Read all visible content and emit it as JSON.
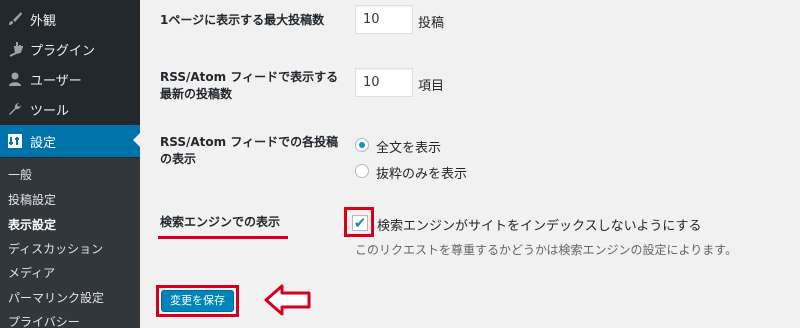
{
  "sidebar": {
    "menu": [
      {
        "label": "外観",
        "icon": "paintbrush-icon"
      },
      {
        "label": "プラグイン",
        "icon": "plugin-icon"
      },
      {
        "label": "ユーザー",
        "icon": "user-icon"
      },
      {
        "label": "ツール",
        "icon": "wrench-icon"
      },
      {
        "label": "設定",
        "icon": "settings-icon",
        "active": true
      }
    ],
    "submenu": [
      {
        "label": "一般"
      },
      {
        "label": "投稿設定"
      },
      {
        "label": "表示設定",
        "current": true
      },
      {
        "label": "ディスカッション"
      },
      {
        "label": "メディア"
      },
      {
        "label": "パーマリンク設定"
      },
      {
        "label": "プライバシー"
      }
    ]
  },
  "settings": {
    "posts_per_page": {
      "label": "1ページに表示する最大投稿数",
      "value": "10",
      "suffix": "投稿"
    },
    "posts_per_rss": {
      "label_line1": "RSS/Atom フィードで表示する",
      "label_line2": "最新の投稿数",
      "value": "10",
      "suffix": "項目"
    },
    "rss_use_excerpt": {
      "label_line1": "RSS/Atom フィードでの各投稿",
      "label_line2": "の表示",
      "options": [
        {
          "label": "全文を表示",
          "checked": true
        },
        {
          "label": "抜粋のみを表示",
          "checked": false
        }
      ]
    },
    "search_engine": {
      "label": "検索エンジンでの表示",
      "checkbox_label": "検索エンジンがサイトをインデックスしないようにする",
      "checked": true,
      "description": "このリクエストを尊重するかどうかは検索エンジンの設定によります。"
    }
  },
  "save_button": {
    "label": "変更を保存"
  },
  "colors": {
    "accent": "#0073aa",
    "highlight": "#d6001c",
    "sidebar_bg": "#23282d"
  }
}
